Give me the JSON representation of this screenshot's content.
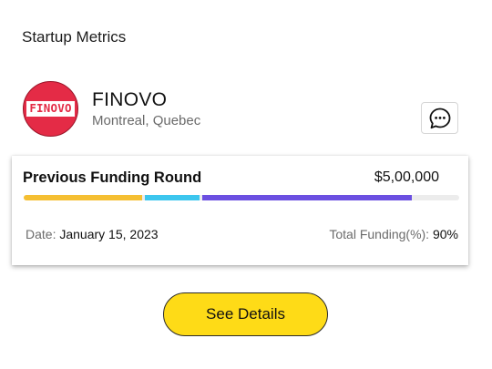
{
  "header": {
    "title": "Startup Metrics"
  },
  "company": {
    "logo_text": "FINOVO",
    "name": "FINOVO",
    "location": "Montreal, Quebec",
    "icons": {
      "message": "chat-bubble-icon"
    }
  },
  "funding": {
    "title": "Previous Funding Round",
    "amount": "$5,00,000",
    "progress_fraction": 0.9,
    "segment_colors": [
      "#f5bf32",
      "#3cc6ee",
      "#6b4fe1"
    ],
    "date_label": "Date:",
    "date_value": "January 15, 2023",
    "total_label": "Total Funding(%):",
    "total_value": "90%"
  },
  "actions": {
    "details_label": "See Details"
  },
  "colors": {
    "logo_bg": "#e42b46",
    "button_bg": "#fedb17",
    "track": "#ececec"
  }
}
